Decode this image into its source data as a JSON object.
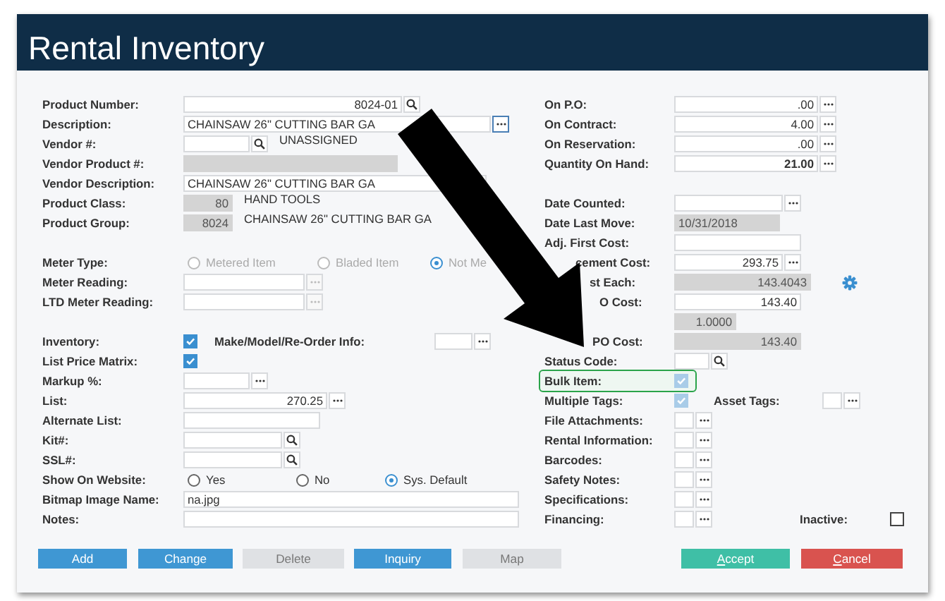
{
  "window": {
    "title": "Rental Inventory"
  },
  "left_fields": [
    {
      "kind": "number",
      "label": "Product Number:",
      "value": "8024-01",
      "button": {
        "kind": "search"
      }
    },
    {
      "kind": "input",
      "label": "Description:",
      "value": "CHAINSAW 26\"  CUTTING BAR GA",
      "button": {
        "kind": "ellipsis"
      },
      "focused": true
    },
    {
      "kind": "input",
      "label": "Vendor #:",
      "button": {
        "kind": "search"
      },
      "note": "UNASSIGNED"
    },
    {
      "kind": "input",
      "label": "Vendor Product #:",
      "readonly": true
    },
    {
      "kind": "input",
      "label": "Vendor Description:",
      "value": "CHAINSAW 26\"  CUTTING BAR GA"
    },
    {
      "kind": "number",
      "label": "Product Class:",
      "value": "80",
      "readonly": true,
      "note": "HAND TOOLS"
    },
    {
      "kind": "number",
      "label": "Product Group:",
      "value": "8024",
      "readonly": true,
      "note": "CHAINSAW 26\" CUTTING BAR GA"
    },
    {
      "kind": "spacer"
    },
    {
      "kind": "radio",
      "label": "Meter Type:",
      "disabled": true,
      "options": [
        {
          "label": "Metered Item",
          "selected": false
        },
        {
          "label": "Bladed Item",
          "selected": false
        },
        {
          "label": "Not Me",
          "selected": true
        }
      ]
    },
    {
      "kind": "input",
      "label": "Meter Reading:",
      "button": {
        "kind": "ellipsis",
        "disabled": true
      }
    },
    {
      "kind": "input",
      "label": "LTD Meter Reading:",
      "button": {
        "kind": "ellipsis",
        "disabled": true
      }
    },
    {
      "kind": "spacer"
    },
    {
      "kind": "checkbox",
      "label": "Inventory:",
      "checked": true,
      "disabled": false,
      "extra": {
        "kind": "input",
        "label": "Make/Model/Re-Order Info:",
        "button": {
          "kind": "ellipsis"
        }
      }
    },
    {
      "kind": "checkbox",
      "label": "List Price Matrix:",
      "checked": true,
      "disabled": false
    },
    {
      "kind": "input",
      "label": "Markup %:",
      "button": {
        "kind": "ellipsis"
      }
    },
    {
      "kind": "number",
      "label": "List:",
      "value": "270.25",
      "button": {
        "kind": "ellipsis"
      }
    },
    {
      "kind": "input",
      "label": "Alternate List:"
    },
    {
      "kind": "input",
      "label": "Kit#:",
      "button": {
        "kind": "search"
      }
    },
    {
      "kind": "input",
      "label": "SSL#:",
      "button": {
        "kind": "search"
      }
    },
    {
      "kind": "radio",
      "label": "Show On Website:",
      "disabled": false,
      "options": [
        {
          "label": "Yes",
          "selected": false
        },
        {
          "label": "No",
          "selected": false
        },
        {
          "label": "Sys. Default",
          "selected": true
        }
      ]
    },
    {
      "kind": "input",
      "label": "Bitmap Image Name:",
      "value": "na.jpg"
    },
    {
      "kind": "input",
      "label": "Notes:"
    }
  ],
  "right_fields": [
    {
      "kind": "number",
      "label": "On P.O:",
      "value": ".00",
      "button": {
        "kind": "ellipsis"
      }
    },
    {
      "kind": "number",
      "label": "On Contract:",
      "value": "4.00",
      "button": {
        "kind": "ellipsis"
      }
    },
    {
      "kind": "number",
      "label": "On Reservation:",
      "value": ".00",
      "button": {
        "kind": "ellipsis"
      }
    },
    {
      "kind": "number",
      "label": "Quantity On Hand:",
      "value": "21.00",
      "button": {
        "kind": "ellipsis"
      },
      "bold": true
    },
    {
      "kind": "spacer"
    },
    {
      "kind": "input",
      "label": "Date Counted:",
      "button": {
        "kind": "ellipsis"
      }
    },
    {
      "kind": "input",
      "label": "Date Last Move:",
      "value": "10/31/2018",
      "readonly": true
    },
    {
      "kind": "input",
      "label": "Adj. First Cost:"
    },
    {
      "kind": "number",
      "label": "cement Cost:",
      "value": "293.75",
      "button": {
        "kind": "ellipsis"
      }
    },
    {
      "kind": "number",
      "label": "st Each:",
      "value": "143.4043",
      "readonly": true,
      "button": {
        "kind": "gear"
      }
    },
    {
      "kind": "number",
      "label": "O Cost:",
      "value": "143.40"
    },
    {
      "kind": "number",
      "value": "1.0000",
      "readonly": true
    },
    {
      "kind": "number",
      "label": "PO Cost:",
      "value": "143.40",
      "readonly": true
    },
    {
      "kind": "input",
      "label": "Status Code:",
      "button": {
        "kind": "search"
      }
    },
    {
      "kind": "checkbox",
      "label": "Bulk Item:",
      "checked": true,
      "disabled": true,
      "highlighted": true
    },
    {
      "kind": "checkbox",
      "label": "Multiple Tags:",
      "checked": true,
      "disabled": true,
      "extra": {
        "kind": "input",
        "label": "Asset Tags:",
        "button": {
          "kind": "ellipsis"
        }
      }
    },
    {
      "kind": "input",
      "label": "File Attachments:",
      "button": {
        "kind": "ellipsis"
      }
    },
    {
      "kind": "input",
      "label": "Rental Information:",
      "button": {
        "kind": "ellipsis"
      }
    },
    {
      "kind": "input",
      "label": "Barcodes:",
      "button": {
        "kind": "ellipsis"
      }
    },
    {
      "kind": "input",
      "label": "Safety Notes:",
      "button": {
        "kind": "ellipsis"
      }
    },
    {
      "kind": "input",
      "label": "Specifications:",
      "button": {
        "kind": "ellipsis"
      }
    },
    {
      "kind": "input",
      "label": "Financing:",
      "button": {
        "kind": "ellipsis"
      },
      "extra": {
        "kind": "checkbox",
        "label": "Inactive:",
        "checked": false
      }
    }
  ],
  "buttons": [
    {
      "label": "Add",
      "kind": "primary",
      "disabled": false
    },
    {
      "label": "Change",
      "kind": "primary",
      "disabled": false
    },
    {
      "label": "Delete",
      "kind": "primary",
      "disabled": true
    },
    {
      "label": "Inquiry",
      "kind": "primary",
      "disabled": false
    },
    {
      "label": "Map",
      "kind": "primary",
      "disabled": true
    },
    {
      "label": "Accept",
      "kind": "accept",
      "disabled": false
    },
    {
      "label": "Cancel",
      "kind": "cancel",
      "disabled": false
    }
  ]
}
